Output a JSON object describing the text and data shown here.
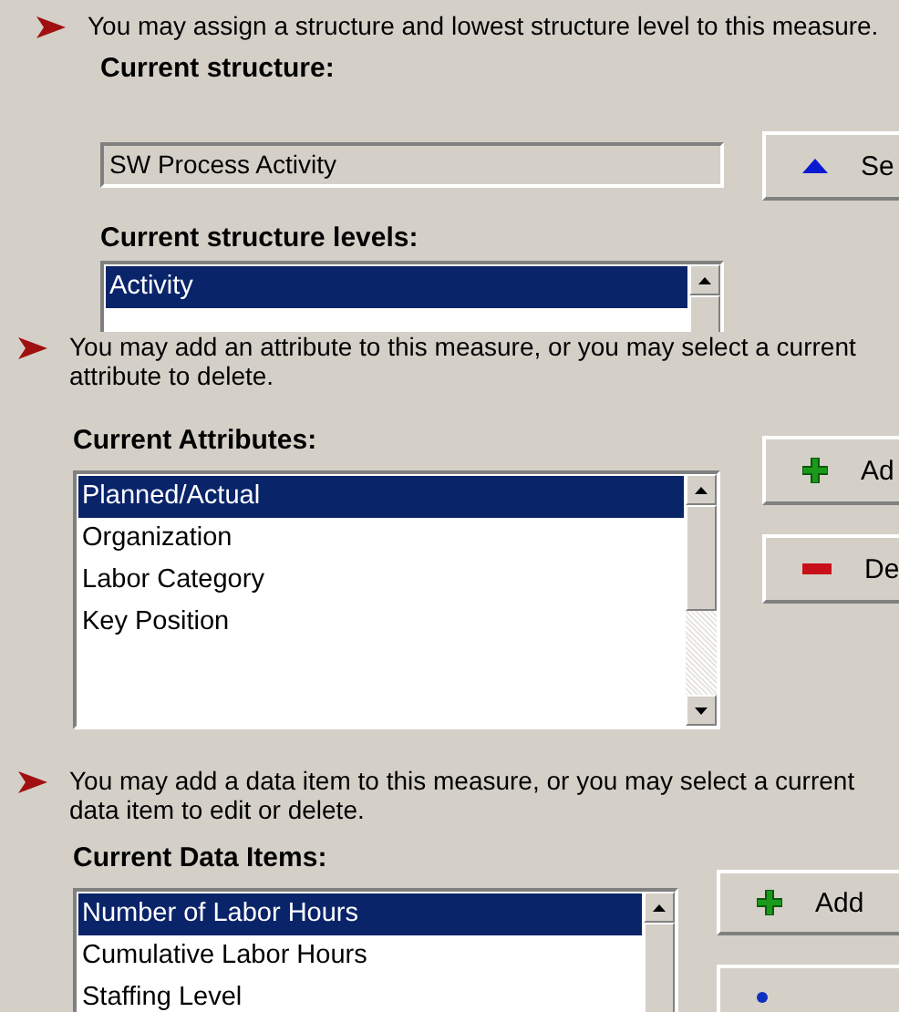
{
  "sections": [
    {
      "kind": "structure",
      "instruction": "You may assign a structure and lowest structure level to this measure.",
      "field_label": "Current structure:",
      "field_value": "SW Process Activity",
      "list_label": "Current structure levels:",
      "items": [
        {
          "label": "Activity",
          "selected": true
        }
      ],
      "buttons": [
        {
          "kind": "up",
          "label": "Se"
        }
      ]
    },
    {
      "kind": "attributes",
      "instruction": "You may add an attribute to this measure, or you may select a current attribute to delete.",
      "list_label": "Current Attributes:",
      "items": [
        {
          "label": "Planned/Actual",
          "selected": true
        },
        {
          "label": "Organization",
          "selected": false
        },
        {
          "label": "Labor Category",
          "selected": false
        },
        {
          "label": "Key Position",
          "selected": false
        }
      ],
      "buttons": [
        {
          "kind": "plus",
          "label": "Ad"
        },
        {
          "kind": "minus",
          "label": "De"
        }
      ]
    },
    {
      "kind": "data_items",
      "instruction": "You may add a data item to this measure, or you may select a current data item to edit or delete.",
      "list_label": "Current Data Items:",
      "items": [
        {
          "label": "Number of Labor Hours",
          "selected": true
        },
        {
          "label": "Cumulative Labor Hours",
          "selected": false
        },
        {
          "label": "Staffing Level",
          "selected": false
        }
      ],
      "buttons": [
        {
          "kind": "plus",
          "label": "Add"
        },
        {
          "kind": "dot"
        }
      ]
    }
  ]
}
